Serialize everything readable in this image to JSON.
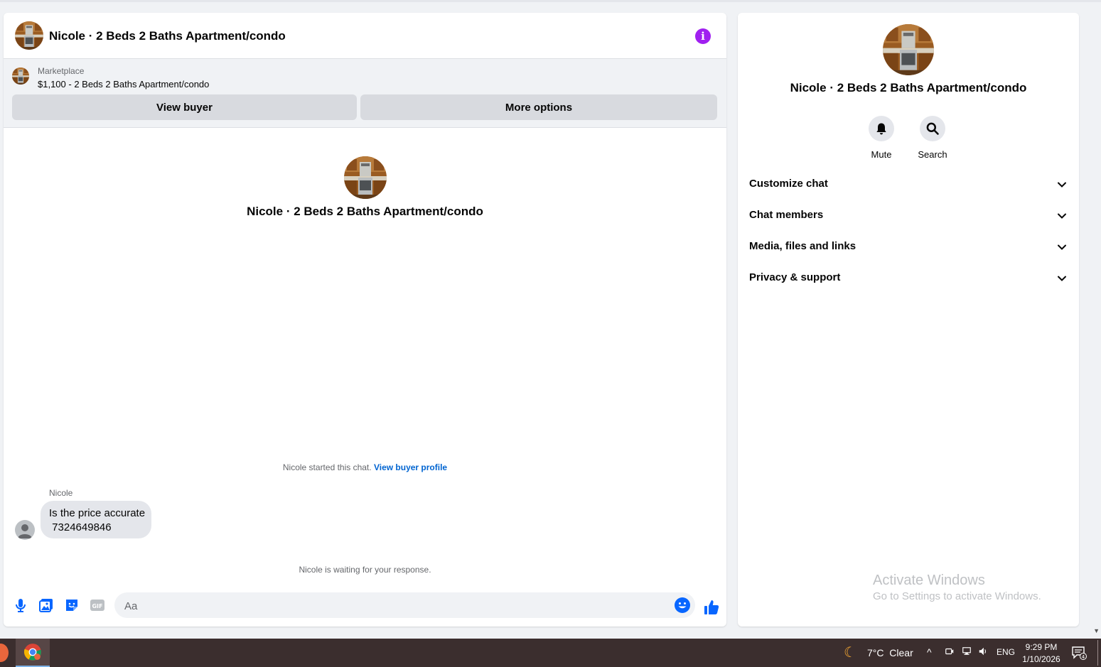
{
  "chat": {
    "title": "Nicole · 2 Beds 2 Baths Apartment/condo",
    "listing": {
      "source": "Marketplace",
      "title": "$1,100 - 2 Beds 2 Baths Apartment/condo",
      "view_buyer_label": "View buyer",
      "more_options_label": "More options"
    },
    "center_title": "Nicole · 2 Beds 2 Baths Apartment/condo",
    "started_text": "Nicole started this chat.",
    "view_profile_link": "View buyer profile",
    "message": {
      "sender": "Nicole",
      "line1": "Is the price accurate",
      "line2": " 7324649846"
    },
    "waiting_text": "Nicole is waiting for your response.",
    "composer": {
      "placeholder": "Aa"
    }
  },
  "side": {
    "title": "Nicole · 2 Beds 2 Baths Apartment/condo",
    "actions": [
      {
        "label": "Mute",
        "icon": "bell-icon"
      },
      {
        "label": "Search",
        "icon": "search-icon"
      }
    ],
    "sections": [
      {
        "label": "Customize chat"
      },
      {
        "label": "Chat members"
      },
      {
        "label": "Media, files and links"
      },
      {
        "label": "Privacy & support"
      }
    ],
    "watermark_title": "Activate Windows",
    "watermark_sub": "Go to Settings to activate Windows."
  },
  "taskbar": {
    "weather": "7°C  Clear",
    "lang": "ENG",
    "time": "9:29 PM",
    "date": "1/10/2026",
    "notifications": "4"
  },
  "colors": {
    "accent": "#0866ff",
    "info": "#a020f0",
    "link": "#0064d1"
  }
}
